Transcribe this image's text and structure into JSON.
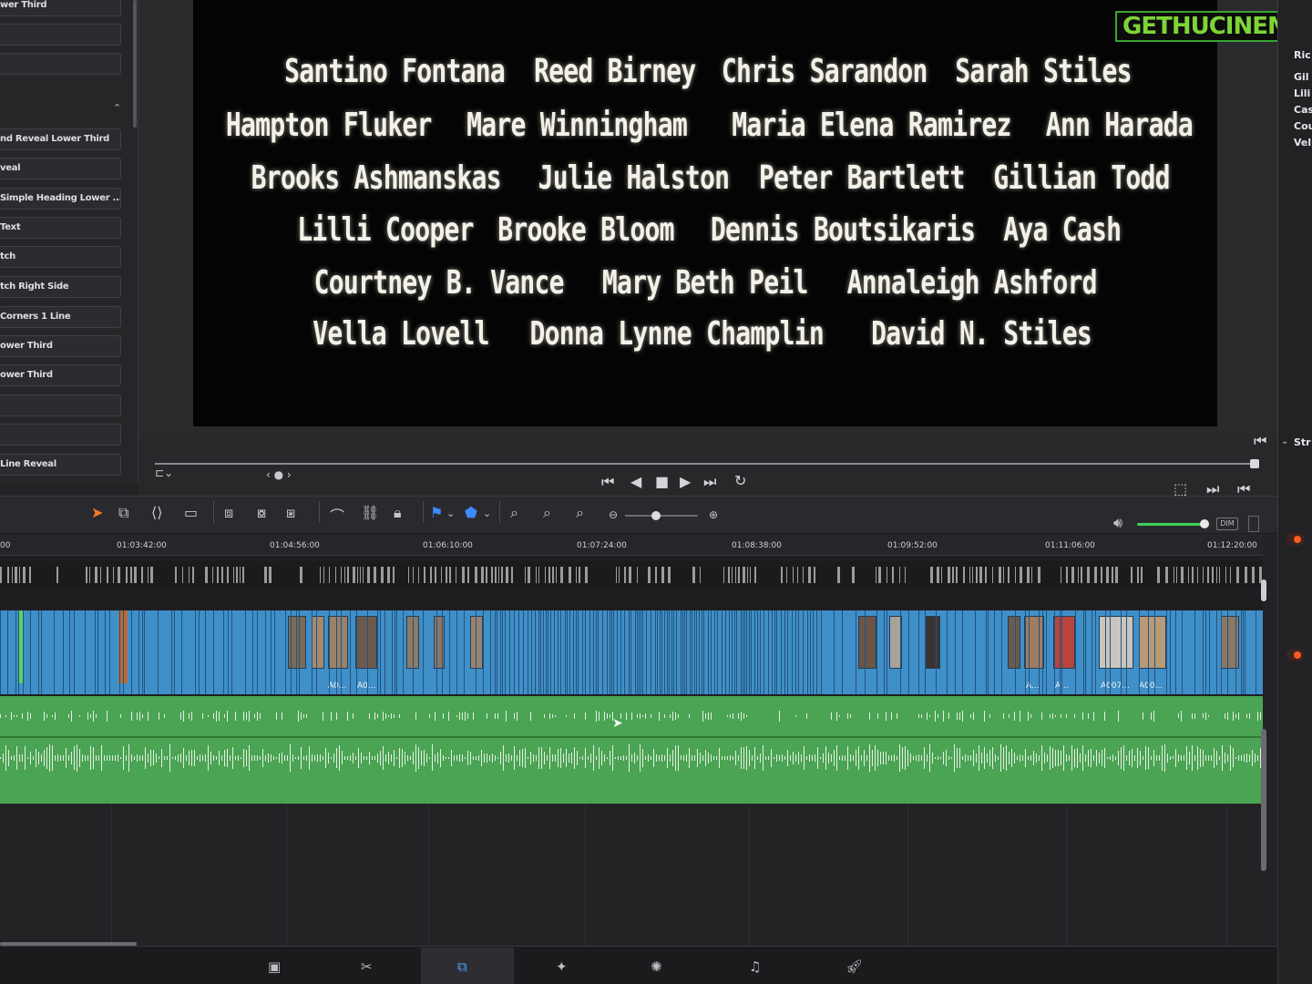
{
  "watermark": {
    "part1": "GETHU",
    "part2": "CINEMA"
  },
  "effects_panel": {
    "items": [
      "wer Third",
      "",
      "",
      "nd Reveal Lower Third",
      "veal",
      "Simple Heading Lower ...",
      "Text",
      "tch",
      "tch Right Side",
      "Corners 1 Line",
      "ower Third",
      "ower Third",
      "",
      "",
      "Line Reveal"
    ]
  },
  "viewer": {
    "credit_rows": [
      [
        "Santino Fontana",
        "Reed Birney",
        "Chris Sarandon",
        "Sarah Stiles"
      ],
      [
        "Hampton Fluker",
        "Mare Winningham",
        "Maria Elena Ramirez",
        "Ann Harada"
      ],
      [
        "Brooks Ashmanskas",
        "Julie Halston",
        "Peter Bartlett",
        "Gillian Todd"
      ],
      [
        "Lilli Cooper",
        "Brooke Bloom",
        "Dennis Boutsikaris",
        "Aya Cash"
      ],
      [
        "Courtney B. Vance",
        "Mary Beth Peil",
        "Annaleigh Ashford"
      ],
      [
        "Vella Lovell",
        "Donna Lynne Champlin",
        "David N. Stiles"
      ]
    ]
  },
  "inspector": {
    "items": [
      "Ric",
      "Gil",
      "Lili",
      "Cas",
      "Cou",
      "Vel",
      "Str"
    ]
  },
  "toolbar": {
    "dim_label": "DIM"
  },
  "timeline": {
    "timecodes": [
      "00",
      "01:03:42:00",
      "01:04:56:00",
      "01:06:10:00",
      "01:07:24:00",
      "01:08:38:00",
      "01:09:52:00",
      "01:11:06:00",
      "01:12:20:00"
    ],
    "clip_labels": [
      "A0...",
      "A0...",
      "A...",
      "A...",
      "A007...",
      "A00..."
    ]
  },
  "colors": {
    "video_clip": "#3f8fc9",
    "audio_clip": "#4aa453",
    "accent_green": "#5dd35a"
  }
}
